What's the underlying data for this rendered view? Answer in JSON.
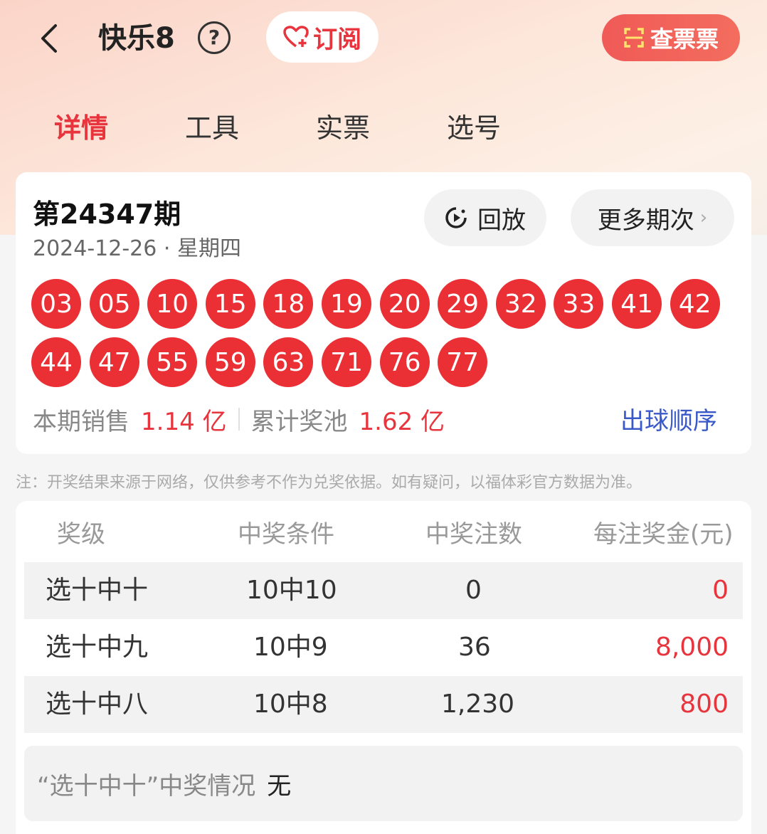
{
  "header": {
    "title": "快乐8",
    "subscribe_label": "订阅",
    "check_ticket_label": "查票票"
  },
  "tabs": [
    {
      "label": "详情",
      "active": true
    },
    {
      "label": "工具",
      "active": false
    },
    {
      "label": "实票",
      "active": false
    },
    {
      "label": "选号",
      "active": false
    }
  ],
  "draw": {
    "issue": "第24347期",
    "date": "2024-12-26 · 星期四",
    "replay_label": "回放",
    "more_label": "更多期次",
    "numbers": [
      "03",
      "05",
      "10",
      "15",
      "18",
      "19",
      "20",
      "29",
      "32",
      "33",
      "41",
      "42",
      "44",
      "47",
      "55",
      "59",
      "63",
      "71",
      "76",
      "77"
    ],
    "sales_label": "本期销售",
    "sales_value": "1.14 亿",
    "pool_label": "累计奖池",
    "pool_value": "1.62 亿",
    "order_link": "出球顺序"
  },
  "note": "注：开奖结果来源于网络，仅供参考不作为兑奖依据。如有疑问，以福体彩官方数据为准。",
  "prize_table": {
    "headers": [
      "奖级",
      "中奖条件",
      "中奖注数",
      "每注奖金(元)"
    ],
    "rows": [
      {
        "level": "选十中十",
        "condition": "10中10",
        "count": "0",
        "amount": "0"
      },
      {
        "level": "选十中九",
        "condition": "10中9",
        "count": "36",
        "amount": "8,000"
      },
      {
        "level": "选十中八",
        "condition": "10中8",
        "count": "1,230",
        "amount": "800"
      }
    ]
  },
  "summary": {
    "label": "“选十中十”中奖情况",
    "value": "无"
  },
  "colors": {
    "accent_red": "#e8343d",
    "ball_red": "#ea2f35",
    "link_blue": "#3a59c9"
  },
  "icons": [
    "back-arrow-icon",
    "help-icon",
    "heart-plus-icon",
    "scan-icon",
    "replay-icon",
    "chevron-right-icon"
  ]
}
